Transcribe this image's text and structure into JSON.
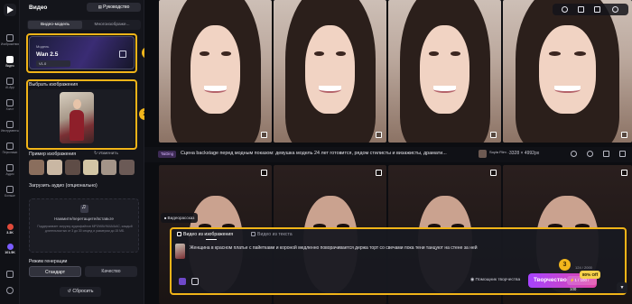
{
  "rail": {
    "items": [
      {
        "label": "Изображения"
      },
      {
        "label": "Видео"
      },
      {
        "label": "AI-App"
      },
      {
        "label": "Холст"
      },
      {
        "label": "Инструменты"
      },
      {
        "label": "Персонажи"
      },
      {
        "label": "Аудио"
      },
      {
        "label": "Больше"
      }
    ],
    "stats": [
      {
        "value": "3.3K",
        "color": "#e04a3a"
      },
      {
        "value": "101.5K",
        "color": "#7a5cff"
      }
    ]
  },
  "panel": {
    "title": "Видео",
    "guide_label": "Руководство",
    "tabs": [
      {
        "label": "Видео-модель",
        "active": true
      },
      {
        "label": "Многоизображе...",
        "active": false
      }
    ],
    "model": {
      "subtitle": "Модель",
      "name": "Wan 2.5",
      "version": "V1.0"
    },
    "select_image_label": "Выбрать изображения",
    "example_label": "Пример изображения",
    "change_label": "Изменить",
    "example_colors": [
      "#8a6e5d",
      "#c9b7a3",
      "#5e4c46",
      "#d2c5a5",
      "#a39488",
      "#6b5a56"
    ],
    "audio_label": "Загрузить аудио (опционально)",
    "audio_main": "Нажмите/перетащите/вставьте",
    "audio_hint": "Поддерживает загрузку аудиофайлов MP3/WAV/M4A/AAC, каждый длительностью от 3 до 30 секунд и размером до 15 МБ.",
    "mode_label": "Режим генерации",
    "modes": [
      {
        "label": "Стандарт",
        "active": true
      },
      {
        "label": "Качество",
        "active": false
      }
    ],
    "reset_label": "Сбросить"
  },
  "badges": [
    "1",
    "2",
    "3"
  ],
  "info": {
    "tag": "TaiDing",
    "caption": "Сцена backstage перед модным показом: девушка модель 24 лет готовится, рядом стилисты и визажисты, драмати...",
    "author_name": "Soyla Film ...",
    "author_sub": "",
    "resolution": "3328 × 4992px"
  },
  "composer": {
    "floating_chip": "Видеорассказ",
    "tabs": [
      {
        "label": "Видео из изображения",
        "active": true
      },
      {
        "label": "Видео из текста",
        "active": false
      }
    ],
    "prompt": "Женщина в красном платье с пайетками и короной медленно поворачивается держа торт со свечами пока тени танцуют на стене за ней",
    "counter": "124 / 2000",
    "assist_label": "Помощник творчества",
    "create_label": "Творчество",
    "credits": "1 / 100 / 100",
    "discount": "80% Off"
  }
}
